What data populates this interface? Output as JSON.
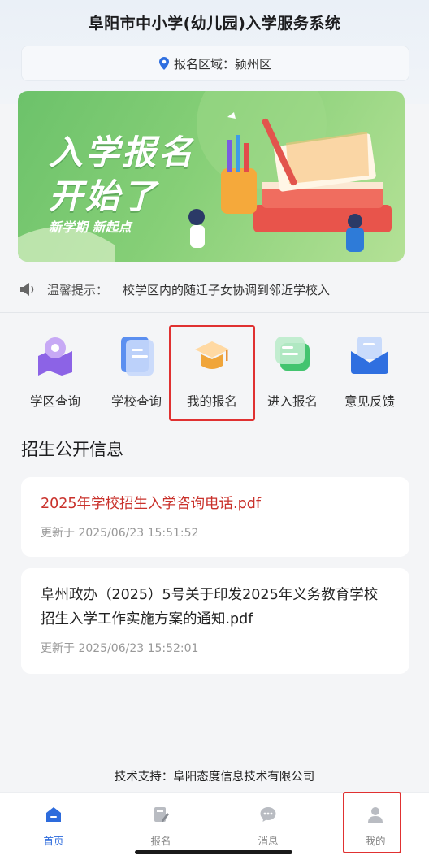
{
  "app": {
    "title": "阜阳市中小学(幼儿园)入学服务系统"
  },
  "region": {
    "label": "报名区域：颍州区",
    "icon": "location-pin-icon"
  },
  "banner": {
    "line1": "入学报名",
    "line2": "开始了",
    "tagline": "新学期 新起点"
  },
  "notice": {
    "label": "温馨提示：",
    "text": "校学区内的随迁子女协调到邻近学校入",
    "icon": "speaker-icon"
  },
  "shortcuts": [
    {
      "label": "学区查询",
      "icon": "map-icon",
      "color": "#8c63e6"
    },
    {
      "label": "学校查询",
      "icon": "document-icon",
      "color": "#5b8ff0"
    },
    {
      "label": "我的报名",
      "icon": "graduation-cap-icon",
      "color": "#f0a53a"
    },
    {
      "label": "进入报名",
      "icon": "chat-edit-icon",
      "color": "#43c46f"
    },
    {
      "label": "意见反馈",
      "icon": "envelope-icon",
      "color": "#2f6fe0"
    }
  ],
  "section": {
    "title": "招生公开信息"
  },
  "announcements": [
    {
      "title": "2025年学校招生入学咨询电话.pdf",
      "updated": "更新于 2025/06/23 15:51:52"
    },
    {
      "title": "阜州政办（2025）5号关于印发2025年义务教育学校招生入学工作实施方案的通知.pdf",
      "updated": "更新于 2025/06/23 15:52:01"
    }
  ],
  "footer": {
    "support": "技术支持：阜阳态度信息技术有限公司"
  },
  "tabbar": [
    {
      "label": "首页",
      "icon": "home-icon",
      "active": true
    },
    {
      "label": "报名",
      "icon": "edit-form-icon",
      "active": false
    },
    {
      "label": "消息",
      "icon": "message-icon",
      "active": false
    },
    {
      "label": "我的",
      "icon": "user-icon",
      "active": false
    }
  ],
  "colors": {
    "accent": "#2d6bdc",
    "highlight": "#e03131",
    "link_red": "#c9312b"
  }
}
